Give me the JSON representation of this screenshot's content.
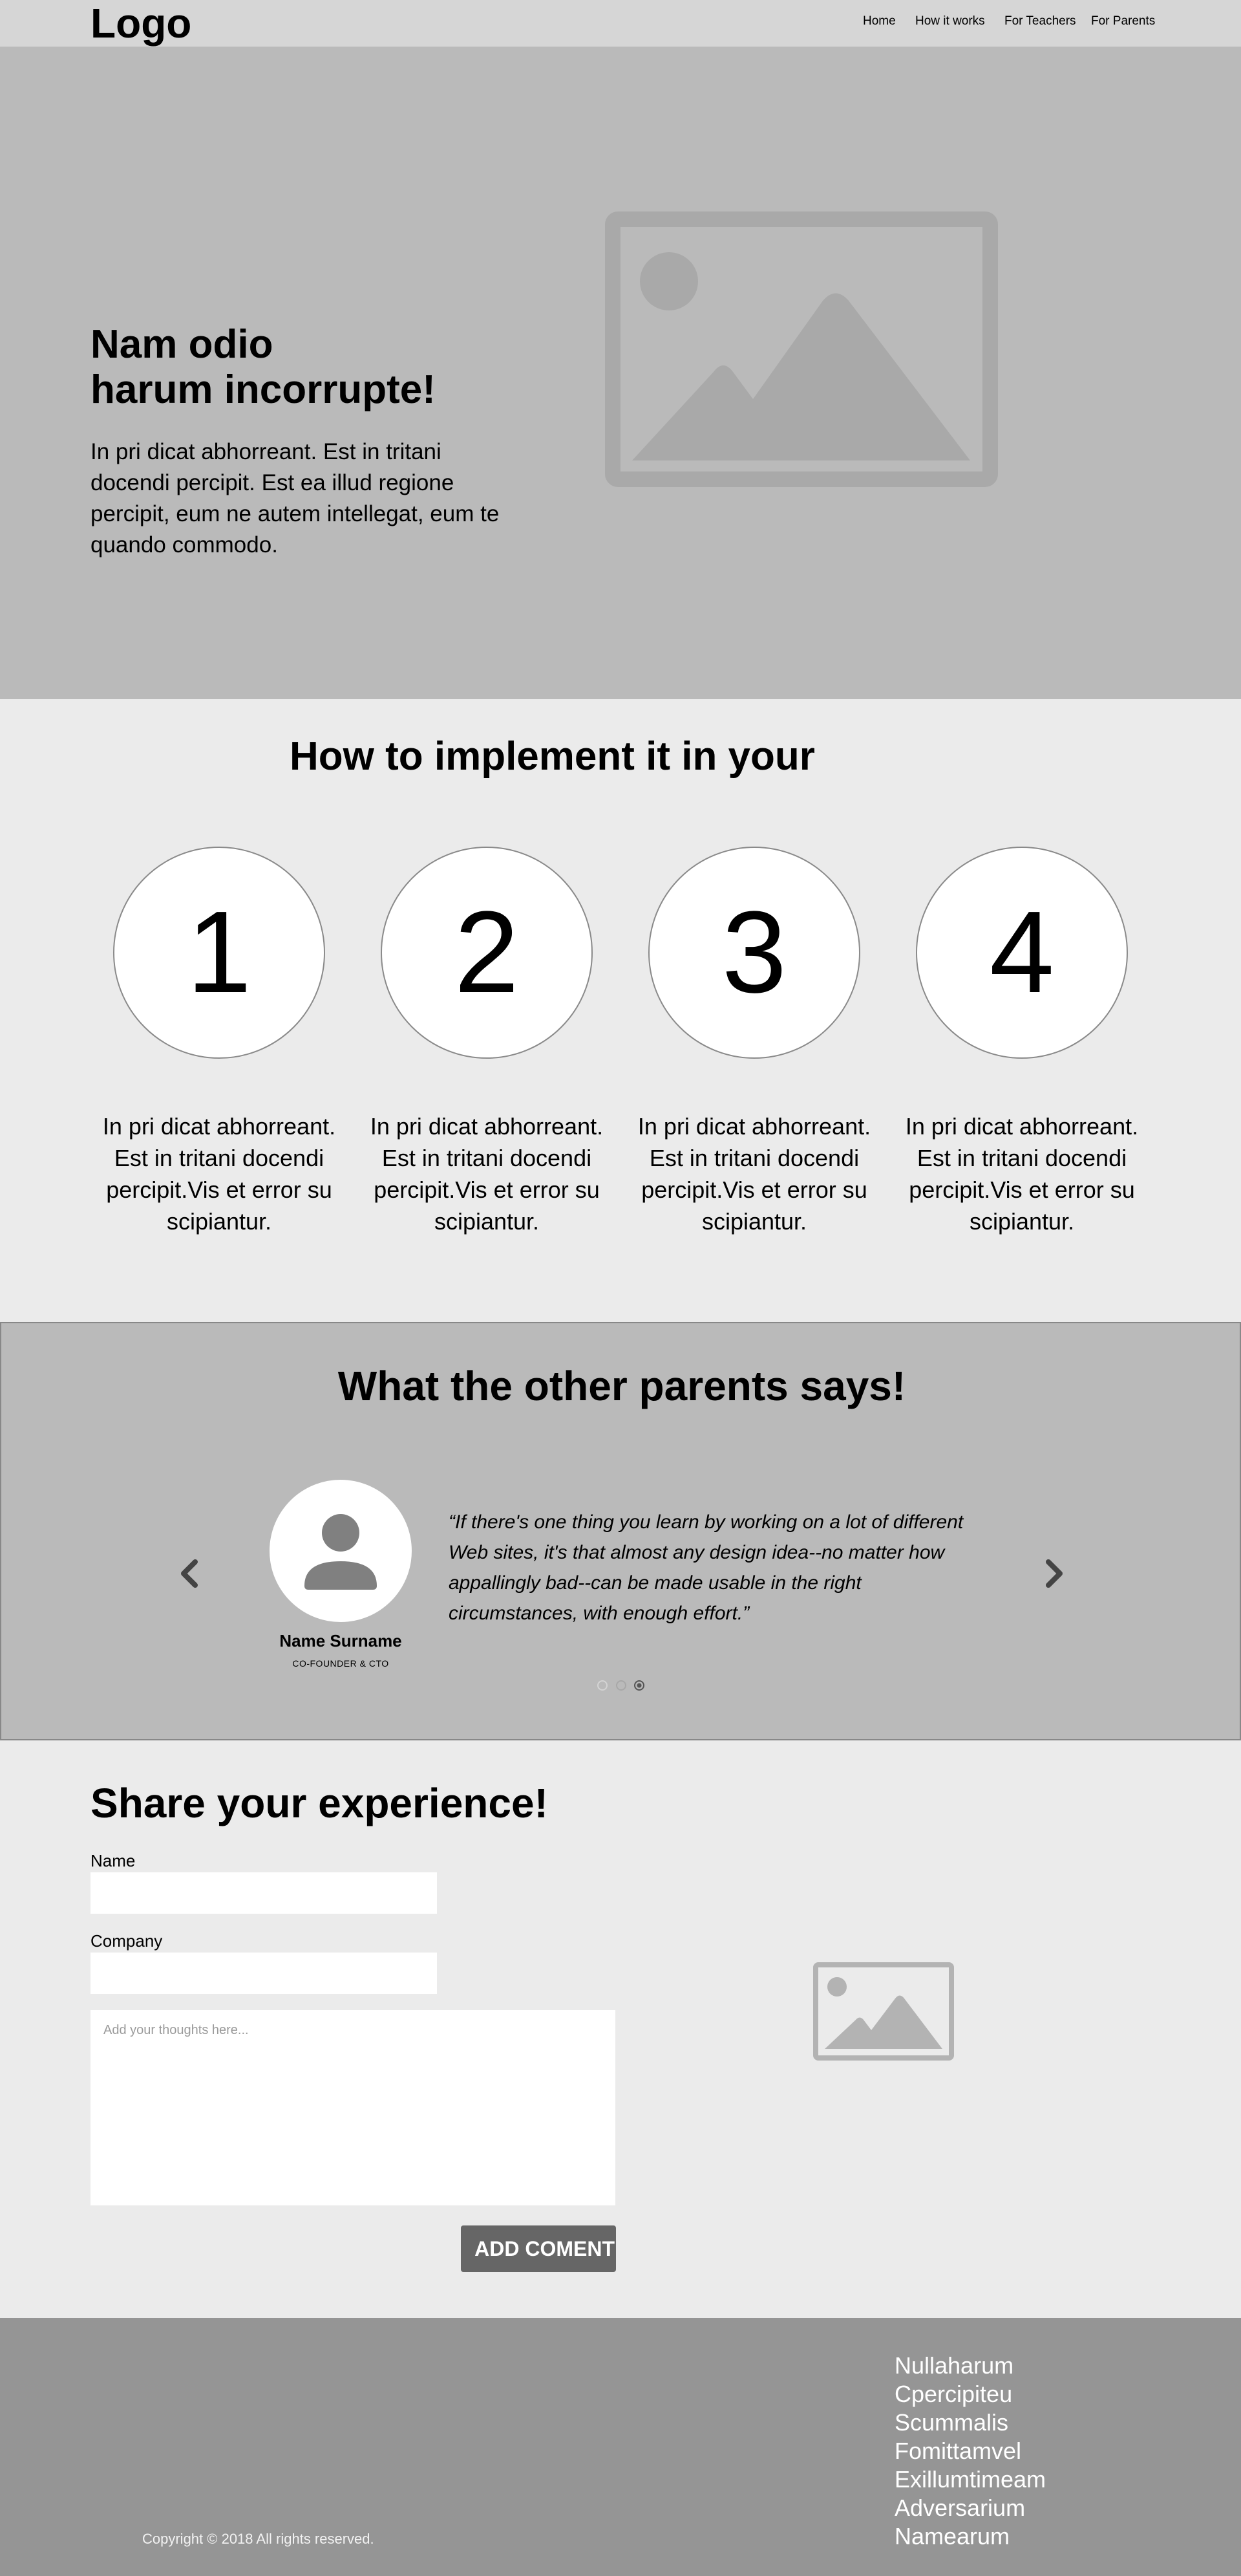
{
  "header": {
    "logo": "Logo",
    "nav": [
      "Home",
      "How it works",
      "For Teachers",
      "For Parents"
    ]
  },
  "hero": {
    "title_line1": "Nam odio",
    "title_line2": "harum incorrupte!",
    "text": "In pri dicat abhorreant. Est in tritani docendi percipit. Est ea illud regione percipit, eum ne autem intellegat, eum te quando commodo.",
    "image_icon": "image-placeholder-icon"
  },
  "how": {
    "title": "How to implement it in your",
    "steps": [
      {
        "number": "1",
        "text": "In pri dicat abhorreant. Est in tritani docendi percipit.Vis et error su scipiantur."
      },
      {
        "number": "2",
        "text": "In pri dicat abhorreant. Est in tritani docendi percipit.Vis et error su scipiantur."
      },
      {
        "number": "3",
        "text": "In pri dicat abhorreant. Est in tritani docendi percipit.Vis et error su scipiantur."
      },
      {
        "number": "4",
        "text": "In pri dicat abhorreant. Est in tritani docendi percipit.Vis et error su scipiantur."
      }
    ]
  },
  "testimonials": {
    "title": "What the other parents says!",
    "name": "Name Surname",
    "role": "CO-FOUNDER & CTO",
    "quote": "“If there's one thing you learn by working on a lot of different Web sites, it's that almost any design idea--no matter how appallingly bad--can be made usable in the right circumstances, with enough effort.”",
    "active_dot": 3,
    "dot_count": 3
  },
  "share": {
    "title": "Share your experience!",
    "name_label": "Name",
    "name_value": "",
    "company_label": "Company",
    "company_value": "",
    "thoughts_placeholder": "Add your thoughts here...",
    "submit_label": "ADD COMENT",
    "image_icon": "image-placeholder-icon"
  },
  "footer": {
    "links": [
      "Nullaharum",
      "Cpercipiteu",
      "Scummalis",
      "Fomittamvel",
      "Exillumtimeam",
      "Adversarium",
      "Namearum"
    ],
    "copyright": "Copyright © 2018 All rights reserved."
  },
  "colors": {
    "header_bg": "#d6d6d6",
    "hero_bg": "#bababa",
    "section_bg": "#ebebeb",
    "button_bg": "#666666",
    "footer_bg": "#959595",
    "placeholder_gray": "#a9a9a9"
  }
}
